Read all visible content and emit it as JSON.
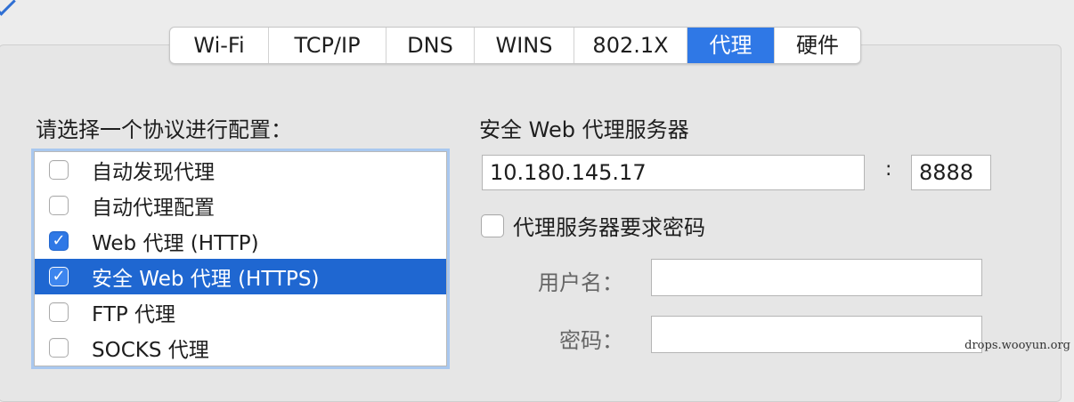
{
  "tabs": [
    "Wi-Fi",
    "TCP/IP",
    "DNS",
    "WINS",
    "802.1X",
    "代理",
    "硬件"
  ],
  "active_tab": "代理",
  "protocol_heading": "请选择一个协议进行配置：",
  "protocols": [
    {
      "label": "自动发现代理",
      "checked": false,
      "selected": false
    },
    {
      "label": "自动代理配置",
      "checked": false,
      "selected": false
    },
    {
      "label": "Web 代理 (HTTP)",
      "checked": true,
      "selected": false
    },
    {
      "label": "安全 Web 代理 (HTTPS)",
      "checked": true,
      "selected": true
    },
    {
      "label": "FTP 代理",
      "checked": false,
      "selected": false
    },
    {
      "label": "SOCKS 代理",
      "checked": false,
      "selected": false
    }
  ],
  "server": {
    "heading": "安全 Web 代理服务器",
    "address": "10.180.145.17",
    "separator": ":",
    "port": "8888"
  },
  "password_required": {
    "label": "代理服务器要求密码",
    "checked": false
  },
  "username_label": "用户名：",
  "username_value": "",
  "password_label": "密码：",
  "password_value": "",
  "watermark": "drops.wooyun.org",
  "colors": {
    "accent": "#2f78e6",
    "selection": "#1f67d1",
    "focus_ring": "#a9c8ef"
  }
}
